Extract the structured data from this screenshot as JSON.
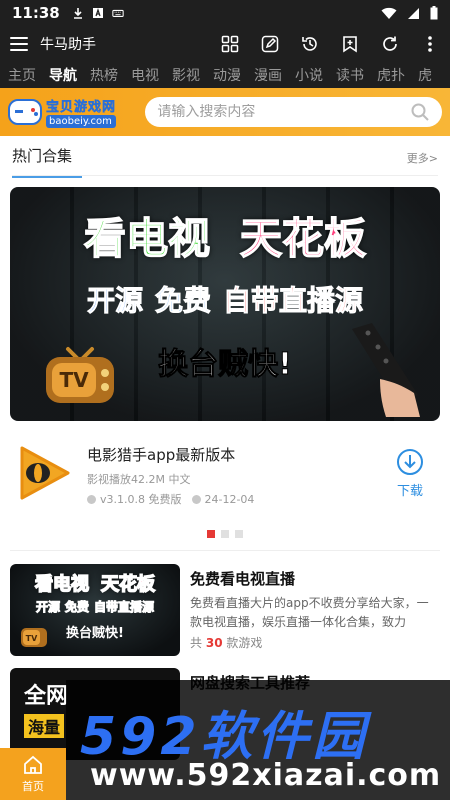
{
  "status_bar": {
    "time": "11:38"
  },
  "app_bar": {
    "title": "牛马助手"
  },
  "tabs": [
    "主页",
    "导航",
    "热榜",
    "电视",
    "影视",
    "动漫",
    "漫画",
    "小说",
    "读书",
    "虎扑",
    "虎"
  ],
  "active_tab": "导航",
  "brand": {
    "logo_cn": "宝贝游戏网",
    "logo_en": "baobeiy.com"
  },
  "search": {
    "placeholder": "请输入搜索内容"
  },
  "section": {
    "title": "热门合集",
    "more": "更多>"
  },
  "banner": {
    "line1_a": "看电视",
    "line1_b": "天花板",
    "line2_a": "开源",
    "line2_b": "免费",
    "line2_c": "自带直播源",
    "line3": "换台贼快!",
    "tv_label": "TV"
  },
  "featured": {
    "name": "电影猎手app最新版本",
    "meta": "影视播放42.2M 中文",
    "version": "v3.1.0.8 免费版",
    "date": "24-12-04",
    "download": "下载"
  },
  "carousel": {
    "count": 3,
    "active": 0
  },
  "collections": [
    {
      "title": "免费看电视直播",
      "desc": "免费看直播大片的app不收费分享给大家，一款电视直播，娱乐直播一体化合集，致力",
      "count_prefix": "共",
      "count": "30",
      "count_suffix": "款游戏",
      "thumb": {
        "l1a": "看电视",
        "l1b": "天花板",
        "l2a": "开源",
        "l2b": "免费",
        "l2c": "自带直播源",
        "l3": "换台贼快!",
        "tv": "TV"
      }
    },
    {
      "title": "网盘搜索工具推荐",
      "thumb": {
        "l1": "全网",
        "l2": "海量"
      }
    }
  ],
  "watermark": {
    "brand": "592软件园",
    "url": "www.592xiazai.com"
  },
  "bottom_nav": {
    "home": "首页"
  },
  "colors": {
    "accent": "#f4a21e",
    "link_blue": "#2d8ee0",
    "active_dot": "#e53935"
  }
}
